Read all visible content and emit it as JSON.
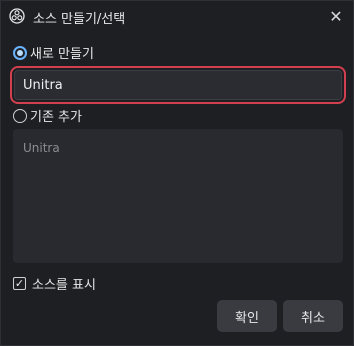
{
  "window": {
    "title": "소스 만들기/선택",
    "app_icon": "obs-logo-icon",
    "close_symbol": "✕"
  },
  "options": {
    "create_new_label": "새로 만들기",
    "add_existing_label": "기존 추가",
    "selected": "create_new"
  },
  "name_input": {
    "value": "Unitra"
  },
  "existing_sources": {
    "items": [
      "Unitra"
    ]
  },
  "visibility": {
    "label": "소스를 표시",
    "checked": true,
    "check_symbol": "✓"
  },
  "buttons": {
    "ok_label": "확인",
    "cancel_label": "취소"
  },
  "colors": {
    "background": "#1e1f23",
    "accent": "#6ab3ff",
    "highlight_outline": "#d2404f",
    "button": "#3a3b41"
  }
}
